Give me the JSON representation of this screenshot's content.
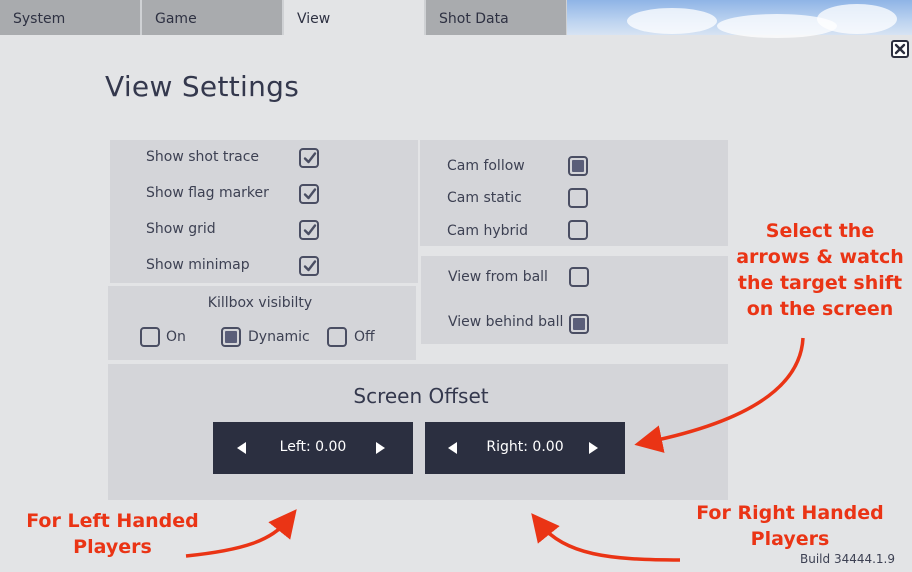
{
  "tabs": [
    {
      "label": "System"
    },
    {
      "label": "Game"
    },
    {
      "label": "View"
    },
    {
      "label": "Shot Data"
    }
  ],
  "page": {
    "title": "View Settings",
    "build": "Build 34444.1.9"
  },
  "display_options": [
    {
      "label": "Show shot trace",
      "checked": true
    },
    {
      "label": "Show flag marker",
      "checked": true
    },
    {
      "label": "Show grid",
      "checked": true
    },
    {
      "label": "Show minimap",
      "checked": true
    }
  ],
  "killbox": {
    "title": "Killbox visibilty",
    "options": [
      {
        "label": "On",
        "selected": false
      },
      {
        "label": "Dynamic",
        "selected": true
      },
      {
        "label": "Off",
        "selected": false
      }
    ]
  },
  "camera_modes": [
    {
      "label": "Cam follow",
      "selected": true
    },
    {
      "label": "Cam static",
      "selected": false
    },
    {
      "label": "Cam hybrid",
      "selected": false
    }
  ],
  "view_modes": [
    {
      "label": "View from ball",
      "selected": false
    },
    {
      "label": "View behind ball",
      "selected": true
    }
  ],
  "screen_offset": {
    "title": "Screen Offset",
    "left": {
      "text": "Left: 0.00"
    },
    "right": {
      "text": "Right: 0.00"
    }
  },
  "annotations": {
    "select_arrows": "Select the arrows & watch the target shift on the screen",
    "left_handed": "For Left Handed Players",
    "right_handed": "For Right Handed Players"
  },
  "colors": {
    "accent_annotation": "#ea3415",
    "button_dark": "#2b2f40",
    "checkbox_fill": "#5a5e79"
  }
}
